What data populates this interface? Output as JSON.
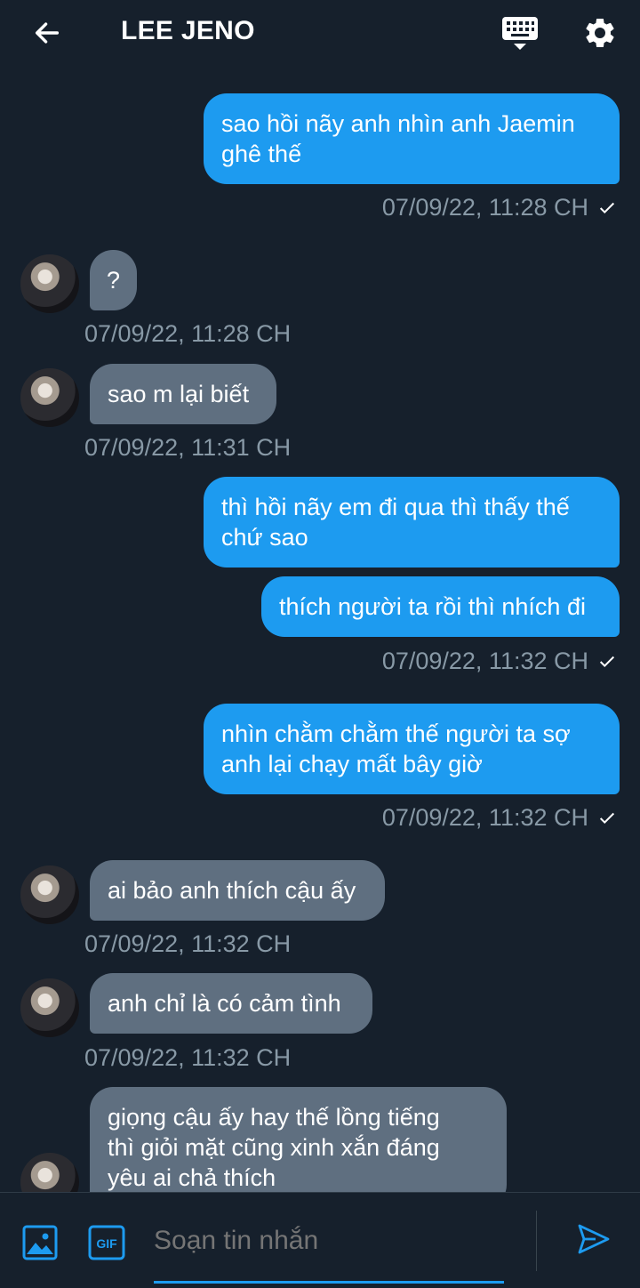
{
  "header": {
    "title": "LEE JENO"
  },
  "messages": [
    {
      "side": "out",
      "text": "sao hồi nãy anh nhìn anh Jaemin\nghê thế",
      "time": "07/09/22, 11:28 CH"
    },
    {
      "side": "in",
      "text": "?",
      "time": "07/09/22, 11:28 CH"
    },
    {
      "side": "in",
      "text": "sao m lại biết",
      "time": "07/09/22, 11:31 CH"
    },
    {
      "side": "out",
      "text": "thì hồi nãy em đi qua thì thấy thế\nchứ sao"
    },
    {
      "side": "out",
      "text": "thích người ta rồi thì nhích đi",
      "time": "07/09/22, 11:32 CH"
    },
    {
      "side": "out",
      "text": "nhìn chằm chằm thế người ta sợ\nanh lại chạy mất bây giờ",
      "time": "07/09/22, 11:32 CH"
    },
    {
      "side": "in",
      "text": "ai bảo anh thích cậu ấy",
      "time": "07/09/22, 11:32 CH"
    },
    {
      "side": "in",
      "text": "anh chỉ là có cảm tình",
      "time": "07/09/22, 11:32 CH"
    },
    {
      "side": "in",
      "text": "giọng cậu ấy hay thế lồng tiếng\nthì giỏi mặt cũng xinh xắn đáng\nyêu ai chả thích"
    }
  ],
  "composer": {
    "placeholder": "Soạn tin nhắn"
  },
  "icons": {
    "back": "arrow-left-icon",
    "keyboard": "keyboard-icon",
    "settings": "gear-icon",
    "image": "image-icon",
    "gif": "gif-icon",
    "send": "send-icon"
  },
  "colors": {
    "background": "#16202c",
    "outgoing": "#1d9bf0",
    "incoming": "#5f6f80",
    "timestamp": "#8899a6"
  }
}
